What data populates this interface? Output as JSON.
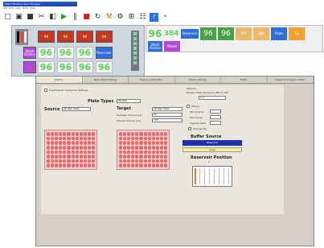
{
  "window": {
    "title": "Plate Handling Deck Manager"
  },
  "menu": [
    "File",
    "Edit",
    "View",
    "Tools",
    "Help"
  ],
  "toolbar": [
    {
      "name": "new-icon",
      "glyph": "□",
      "color": "#333"
    },
    {
      "name": "open-icon",
      "glyph": "▣",
      "color": "#333"
    },
    {
      "name": "save-icon",
      "glyph": "■",
      "color": "#333"
    },
    {
      "name": "cut-icon",
      "glyph": "✂",
      "color": "#333"
    },
    {
      "name": "paste-icon",
      "glyph": "◧",
      "color": "#333"
    },
    {
      "name": "run-icon",
      "glyph": "▶",
      "color": "#1fa31f"
    },
    {
      "name": "pause-icon",
      "glyph": "‖",
      "color": "#333"
    },
    {
      "name": "stop-icon",
      "glyph": "■",
      "color": "#d02020"
    },
    {
      "name": "refresh-icon",
      "glyph": "↻",
      "color": "#333"
    },
    {
      "name": "tool-icon",
      "glyph": "⚒",
      "color": "#c08020"
    },
    {
      "name": "settings-icon",
      "glyph": "⚙",
      "color": "#333"
    },
    {
      "name": "layout-icon",
      "glyph": "⊞",
      "color": "#333"
    },
    {
      "name": "table-icon",
      "glyph": "☷",
      "color": "#333"
    },
    {
      "name": "help-icon",
      "glyph": "?",
      "color": "#ffffff"
    },
    {
      "name": "info-icon",
      "glyph": "•",
      "color": "#888"
    }
  ],
  "deck": {
    "row1": [
      "96",
      "96",
      "96",
      "96"
    ],
    "row2_first": "Wash Station",
    "row3": [
      "96",
      "96",
      "96",
      "96"
    ],
    "reservoir": "Reservoir"
  },
  "hopper": {
    "plate1": "96",
    "plate2": "384",
    "blue1": "Reservoir",
    "tip1": "96",
    "tip2": "96",
    "labels": [
      "P/V",
      "384",
      "Plate",
      "Tip"
    ],
    "purple1": "Wash Station",
    "purple2": "Waste"
  },
  "tabs": [
    "Dilution",
    "Plate Reformatting",
    "Pooling Application",
    "Cherry Picking",
    "ELISA",
    "Advanced Program Editor"
  ],
  "form": {
    "use_preset_label": "Use Program Sequence Settings",
    "plate_types_label": "Plate Types",
    "plate_types_value": "96 Well",
    "source_label": "Source",
    "source_value": "96 Well Plate",
    "target_label": "Target",
    "target_value": "96 Well Plate",
    "samples_label": "Samples Volume (uL)",
    "samples_value": "50",
    "diluent_label": "Diluent Volume (uL)",
    "diluent_value": "100",
    "options_label": "Options",
    "dilution_label": "Dilution Step Sequence (Bit by bit)",
    "dilution_value": "1:2",
    "mixing_label": "Mixing",
    "mix_vol_label": "Mix Volume",
    "mix_cycles_label": "Mix Cycles",
    "aspirate_label": "Aspirate Rate",
    "change_tip_label": "Change Tip",
    "buffer_source_label": "Buffer Source",
    "buffer_reservoir": "Reservoir",
    "buffer_plate": "Plate",
    "reservoir_position_label": "Reservoir Position",
    "reservoir_position_value": "1"
  }
}
